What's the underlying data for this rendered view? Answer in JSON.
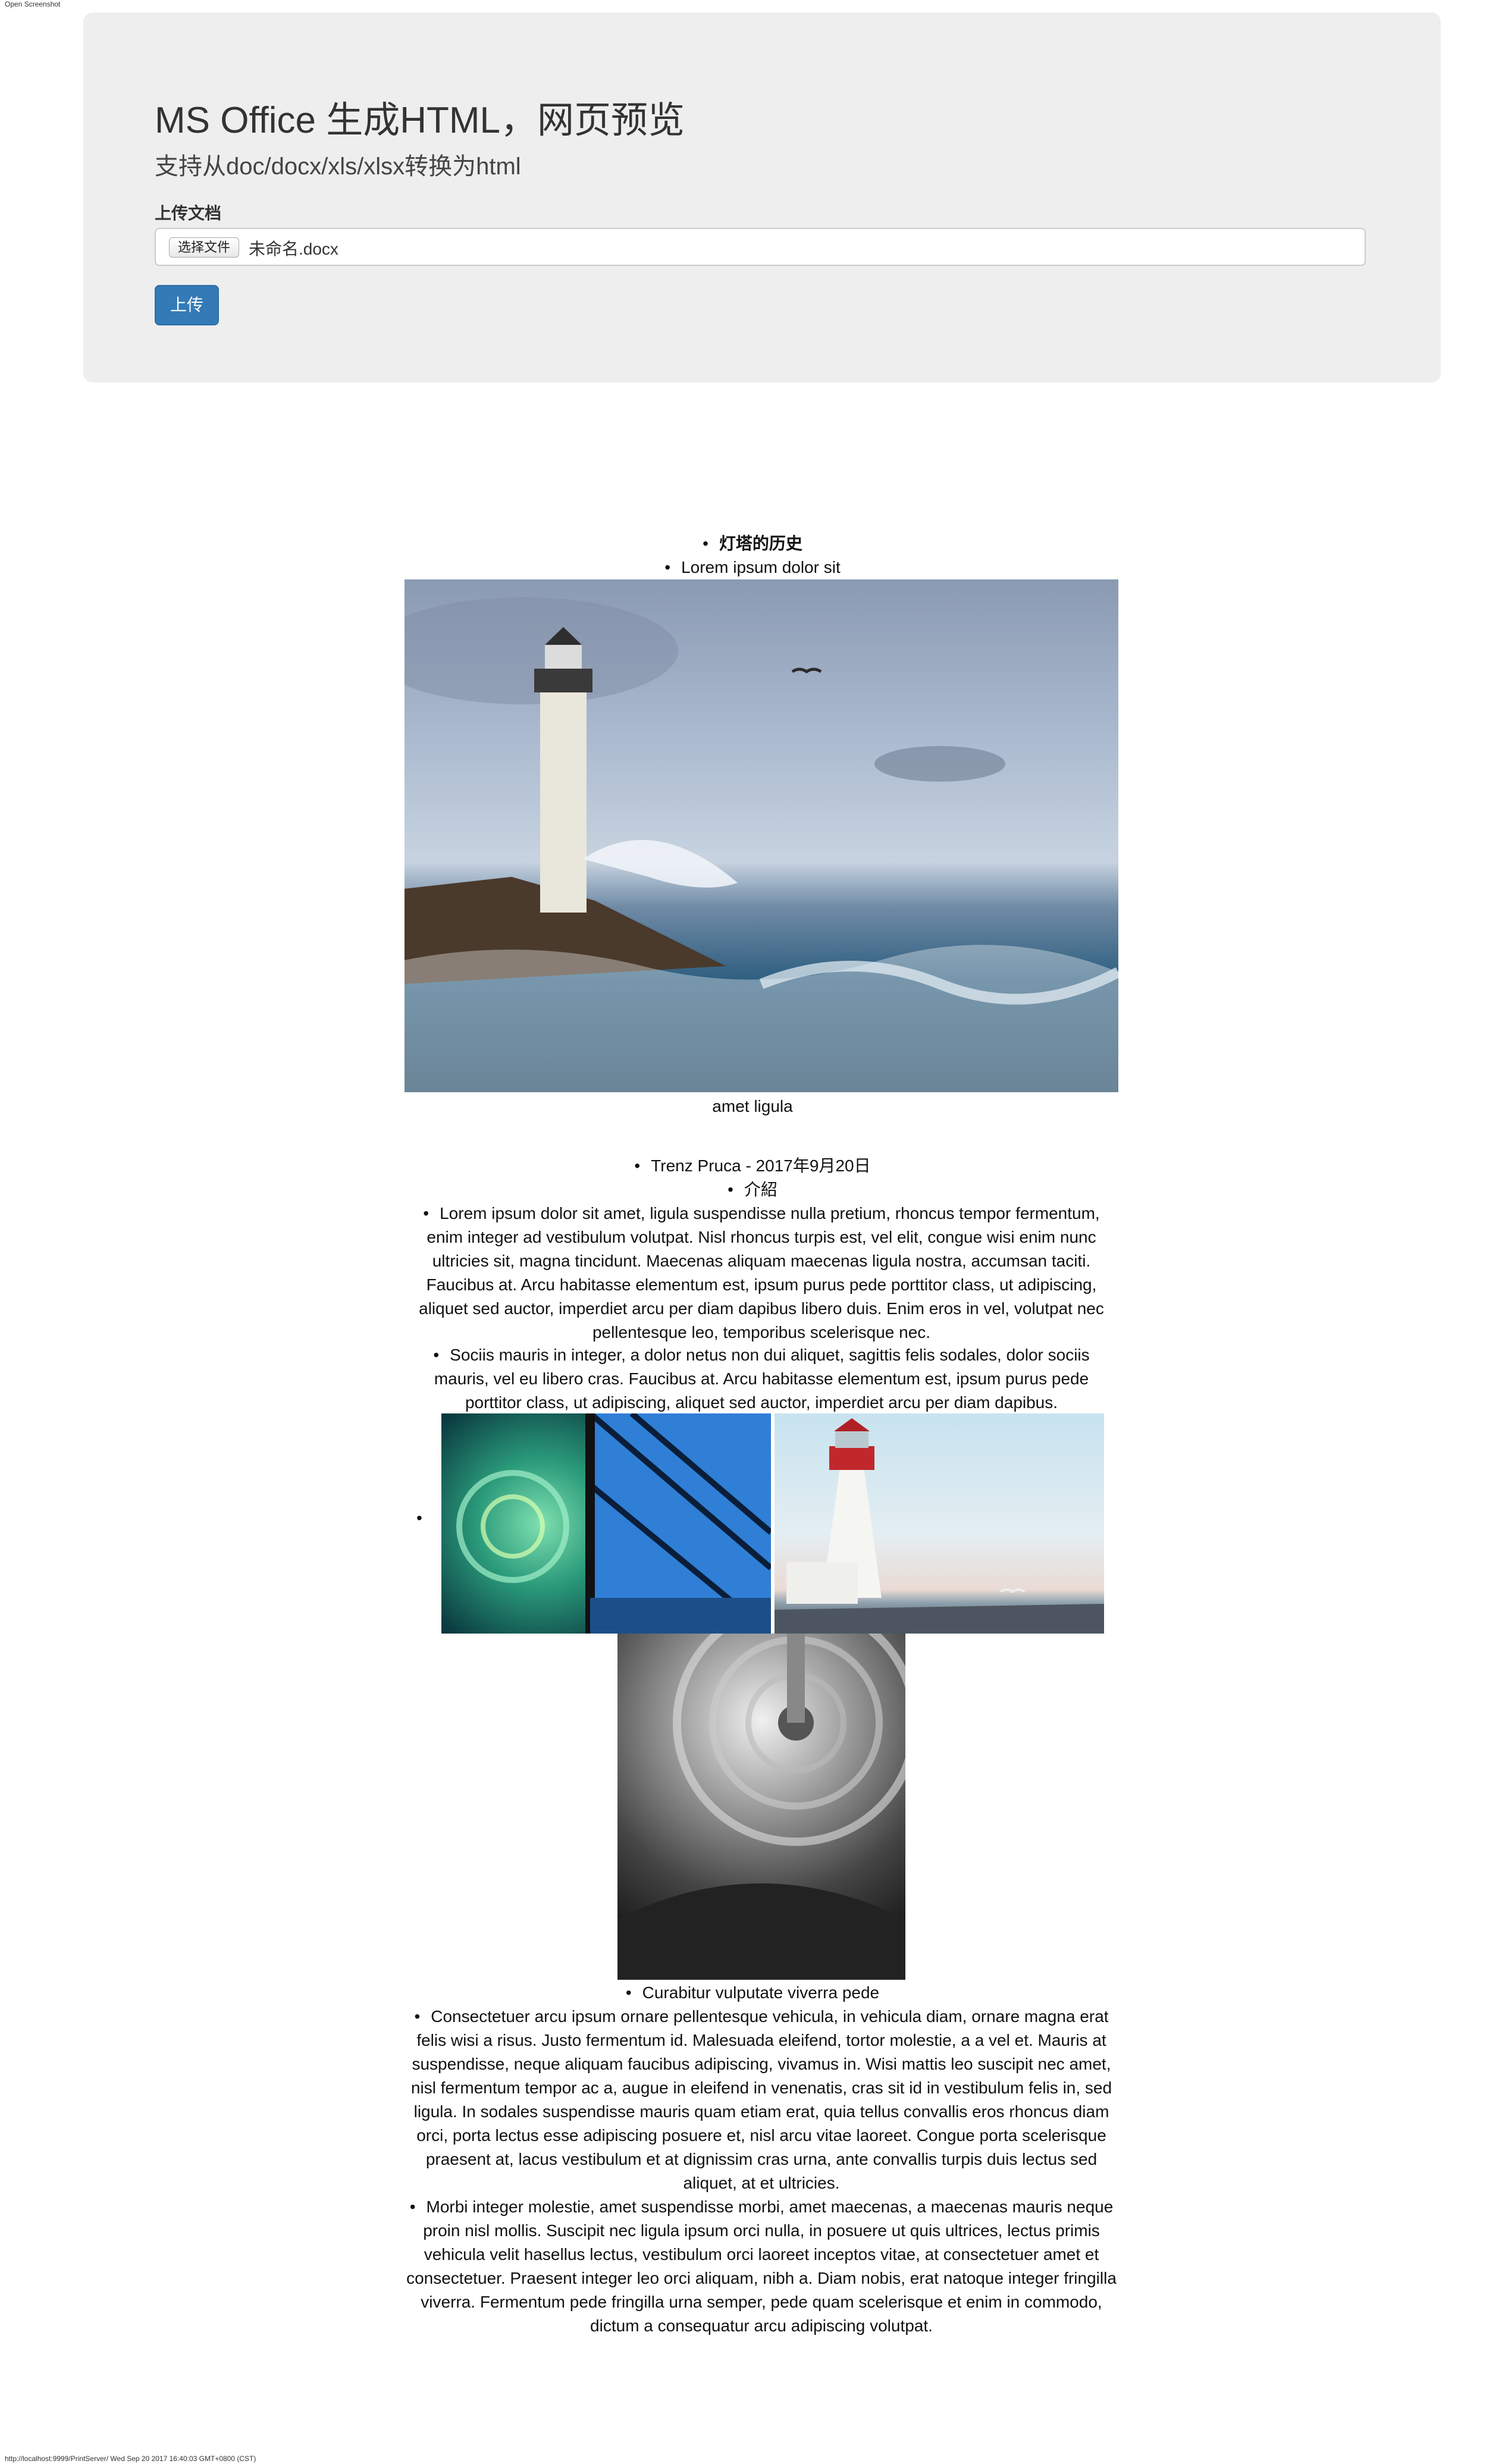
{
  "window": {
    "top_label": "Open Screenshot",
    "footer_text": "http://localhost:9999/PrintServer/ Wed Sep 20 2017 16:40:03 GMT+0800 (CST)"
  },
  "header": {
    "title": "MS Office 生成HTML，网页预览",
    "subtitle": "支持从doc/docx/xls/xlsx转换为html",
    "upload_label": "上传文档",
    "choose_file_label": "选择文件",
    "file_name": "未命名.docx",
    "upload_button": "上传"
  },
  "document": {
    "bullet": "•",
    "line1": "灯塔的历史",
    "line2": "Lorem ipsum dolor sit",
    "caption1": "amet ligula",
    "line3": "Trenz Pruca - 2017年9月20日",
    "line4": "介紹",
    "para1": "Lorem ipsum dolor sit amet, ligula suspendisse nulla pretium, rhoncus tempor fermentum, enim integer ad vestibulum volutpat. Nisl rhoncus turpis est, vel elit, congue wisi enim nunc ultricies sit, magna tincidunt. Maecenas aliquam maecenas ligula nostra, accumsan taciti. Faucibus at. Arcu habitasse elementum est, ipsum purus pede porttitor class, ut adipiscing, aliquet sed auctor, imperdiet arcu per diam dapibus libero duis. Enim eros in vel, volutpat nec pellentesque leo, temporibus scelerisque nec.",
    "para2": "Sociis mauris in integer, a dolor netus non dui aliquet, sagittis felis sodales, dolor sociis mauris, vel eu libero cras. Faucibus at. Arcu habitasse elementum est, ipsum purus pede porttitor class, ut adipiscing, aliquet sed auctor, imperdiet arcu per diam dapibus.",
    "line5": "Curabitur vulputate viverra pede",
    "para3": "Consectetuer arcu ipsum ornare pellentesque vehicula, in vehicula diam, ornare magna erat felis wisi a risus. Justo fermentum id. Malesuada eleifend, tortor molestie, a a vel et. Mauris at suspendisse, neque aliquam faucibus adipiscing, vivamus in. Wisi mattis leo suscipit nec amet, nisl fermentum tempor ac a, augue in eleifend in venenatis, cras sit id in vestibulum felis in, sed ligula. In sodales suspendisse mauris quam etiam erat, quia tellus convallis eros rhoncus diam orci, porta lectus esse adipiscing posuere et, nisl arcu vitae laoreet. Congue porta scelerisque praesent at, lacus vestibulum et at dignissim cras urna, ante convallis turpis duis lectus sed aliquet, at et ultricies.",
    "para4": "Morbi integer molestie, amet suspendisse morbi, amet maecenas, a maecenas mauris neque proin nisl mollis. Suscipit nec ligula ipsum orci nulla, in posuere ut quis ultrices, lectus primis vehicula velit hasellus lectus, vestibulum orci laoreet inceptos vitae, at consectetuer amet et consectetuer. Praesent integer leo orci aliquam, nibh a. Diam nobis, erat natoque integer fringilla viverra. Fermentum pede fringilla urna semper, pede quam scelerisque et enim in commodo, dictum a consequatur arcu adipiscing volutpat."
  }
}
